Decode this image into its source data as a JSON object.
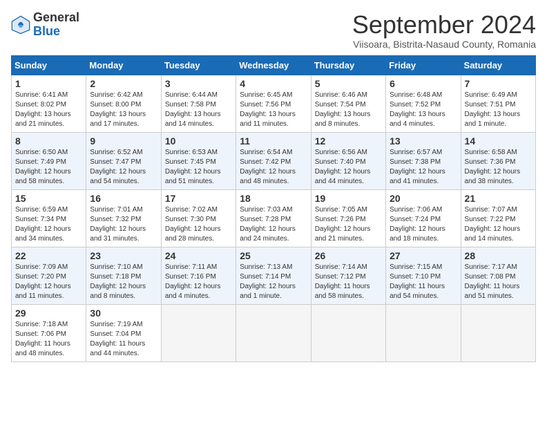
{
  "logo": {
    "general": "General",
    "blue": "Blue"
  },
  "header": {
    "month": "September 2024",
    "location": "Viisoara, Bistrita-Nasaud County, Romania"
  },
  "days_of_week": [
    "Sunday",
    "Monday",
    "Tuesday",
    "Wednesday",
    "Thursday",
    "Friday",
    "Saturday"
  ],
  "weeks": [
    [
      {
        "day": "1",
        "info": "Sunrise: 6:41 AM\nSunset: 8:02 PM\nDaylight: 13 hours\nand 21 minutes."
      },
      {
        "day": "2",
        "info": "Sunrise: 6:42 AM\nSunset: 8:00 PM\nDaylight: 13 hours\nand 17 minutes."
      },
      {
        "day": "3",
        "info": "Sunrise: 6:44 AM\nSunset: 7:58 PM\nDaylight: 13 hours\nand 14 minutes."
      },
      {
        "day": "4",
        "info": "Sunrise: 6:45 AM\nSunset: 7:56 PM\nDaylight: 13 hours\nand 11 minutes."
      },
      {
        "day": "5",
        "info": "Sunrise: 6:46 AM\nSunset: 7:54 PM\nDaylight: 13 hours\nand 8 minutes."
      },
      {
        "day": "6",
        "info": "Sunrise: 6:48 AM\nSunset: 7:52 PM\nDaylight: 13 hours\nand 4 minutes."
      },
      {
        "day": "7",
        "info": "Sunrise: 6:49 AM\nSunset: 7:51 PM\nDaylight: 13 hours\nand 1 minute."
      }
    ],
    [
      {
        "day": "8",
        "info": "Sunrise: 6:50 AM\nSunset: 7:49 PM\nDaylight: 12 hours\nand 58 minutes."
      },
      {
        "day": "9",
        "info": "Sunrise: 6:52 AM\nSunset: 7:47 PM\nDaylight: 12 hours\nand 54 minutes."
      },
      {
        "day": "10",
        "info": "Sunrise: 6:53 AM\nSunset: 7:45 PM\nDaylight: 12 hours\nand 51 minutes."
      },
      {
        "day": "11",
        "info": "Sunrise: 6:54 AM\nSunset: 7:42 PM\nDaylight: 12 hours\nand 48 minutes."
      },
      {
        "day": "12",
        "info": "Sunrise: 6:56 AM\nSunset: 7:40 PM\nDaylight: 12 hours\nand 44 minutes."
      },
      {
        "day": "13",
        "info": "Sunrise: 6:57 AM\nSunset: 7:38 PM\nDaylight: 12 hours\nand 41 minutes."
      },
      {
        "day": "14",
        "info": "Sunrise: 6:58 AM\nSunset: 7:36 PM\nDaylight: 12 hours\nand 38 minutes."
      }
    ],
    [
      {
        "day": "15",
        "info": "Sunrise: 6:59 AM\nSunset: 7:34 PM\nDaylight: 12 hours\nand 34 minutes."
      },
      {
        "day": "16",
        "info": "Sunrise: 7:01 AM\nSunset: 7:32 PM\nDaylight: 12 hours\nand 31 minutes."
      },
      {
        "day": "17",
        "info": "Sunrise: 7:02 AM\nSunset: 7:30 PM\nDaylight: 12 hours\nand 28 minutes."
      },
      {
        "day": "18",
        "info": "Sunrise: 7:03 AM\nSunset: 7:28 PM\nDaylight: 12 hours\nand 24 minutes."
      },
      {
        "day": "19",
        "info": "Sunrise: 7:05 AM\nSunset: 7:26 PM\nDaylight: 12 hours\nand 21 minutes."
      },
      {
        "day": "20",
        "info": "Sunrise: 7:06 AM\nSunset: 7:24 PM\nDaylight: 12 hours\nand 18 minutes."
      },
      {
        "day": "21",
        "info": "Sunrise: 7:07 AM\nSunset: 7:22 PM\nDaylight: 12 hours\nand 14 minutes."
      }
    ],
    [
      {
        "day": "22",
        "info": "Sunrise: 7:09 AM\nSunset: 7:20 PM\nDaylight: 12 hours\nand 11 minutes."
      },
      {
        "day": "23",
        "info": "Sunrise: 7:10 AM\nSunset: 7:18 PM\nDaylight: 12 hours\nand 8 minutes."
      },
      {
        "day": "24",
        "info": "Sunrise: 7:11 AM\nSunset: 7:16 PM\nDaylight: 12 hours\nand 4 minutes."
      },
      {
        "day": "25",
        "info": "Sunrise: 7:13 AM\nSunset: 7:14 PM\nDaylight: 12 hours\nand 1 minute."
      },
      {
        "day": "26",
        "info": "Sunrise: 7:14 AM\nSunset: 7:12 PM\nDaylight: 11 hours\nand 58 minutes."
      },
      {
        "day": "27",
        "info": "Sunrise: 7:15 AM\nSunset: 7:10 PM\nDaylight: 11 hours\nand 54 minutes."
      },
      {
        "day": "28",
        "info": "Sunrise: 7:17 AM\nSunset: 7:08 PM\nDaylight: 11 hours\nand 51 minutes."
      }
    ],
    [
      {
        "day": "29",
        "info": "Sunrise: 7:18 AM\nSunset: 7:06 PM\nDaylight: 11 hours\nand 48 minutes."
      },
      {
        "day": "30",
        "info": "Sunrise: 7:19 AM\nSunset: 7:04 PM\nDaylight: 11 hours\nand 44 minutes."
      },
      {
        "day": "",
        "info": ""
      },
      {
        "day": "",
        "info": ""
      },
      {
        "day": "",
        "info": ""
      },
      {
        "day": "",
        "info": ""
      },
      {
        "day": "",
        "info": ""
      }
    ]
  ]
}
